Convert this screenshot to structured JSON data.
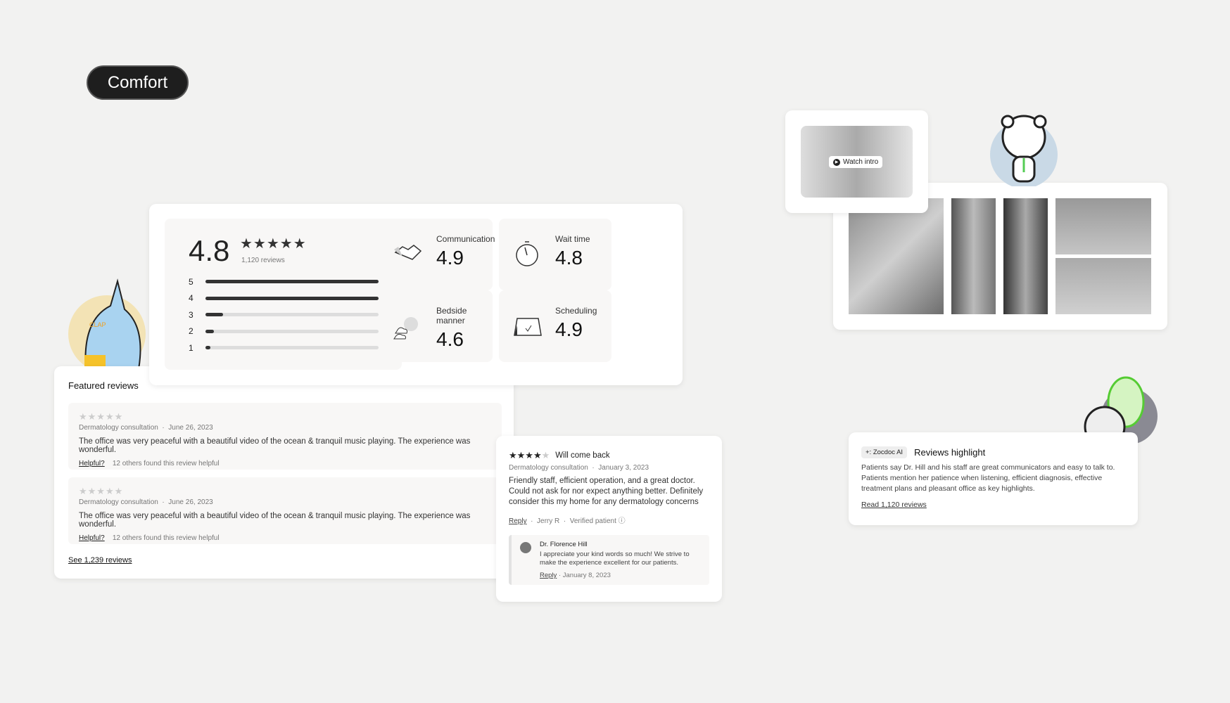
{
  "tag": "Comfort",
  "summary": {
    "rating": "4.8",
    "stars": "★★★★★",
    "reviews": "1,120 reviews",
    "bars": [
      {
        "label": "5",
        "fill": 100
      },
      {
        "label": "4",
        "fill": 100
      },
      {
        "label": "3",
        "fill": 10
      },
      {
        "label": "2",
        "fill": 5
      },
      {
        "label": "1",
        "fill": 1
      }
    ]
  },
  "metrics": [
    {
      "label": "Communication",
      "value": "4.9",
      "icon": "handshake-icon"
    },
    {
      "label": "Wait time",
      "value": "4.8",
      "icon": "stopwatch-icon"
    },
    {
      "label": "Bedside manner",
      "value": "4.6",
      "icon": "sun-cloud-icon"
    },
    {
      "label": "Scheduling",
      "value": "4.9",
      "icon": "calendar-check-icon"
    }
  ],
  "featured": {
    "title": "Featured reviews",
    "see_all": "See 1,239 reviews",
    "reviews": [
      {
        "stars": "★★★★★",
        "type": "Dermatology consultation",
        "date": "June 26, 2023",
        "text": "The office was very peaceful with a beautiful video of the ocean & tranquil music playing. The experience was wonderful.",
        "helpful": "Helpful?",
        "helpful_count": "12 others found this review helpful"
      },
      {
        "stars": "★★★★★",
        "type": "Dermatology consultation",
        "date": "June 26, 2023",
        "text": "The office was very peaceful with a beautiful video of the ocean & tranquil music playing. The experience was wonderful.",
        "helpful": "Helpful?",
        "helpful_count": "12 others found this review helpful"
      }
    ]
  },
  "review": {
    "stars_filled": "★★★★",
    "stars_empty": "★",
    "rating": 4,
    "title": "Will come back",
    "type": "Dermatology consultation",
    "date": "January 3, 2023",
    "text": "Friendly staff, efficient operation, and a great doctor. Could not ask for nor expect anything better. Definitely consider this my home for any dermatology concerns",
    "reply": "Reply",
    "author": "Jerry R",
    "verified": "Verified patient",
    "response": {
      "name": "Dr. Florence Hill",
      "text": "I appreciate your kind words so much! We strive to make the experience excellent for our patients.",
      "reply": "Reply",
      "date": "January 8, 2023"
    }
  },
  "video": {
    "label": "Watch intro"
  },
  "highlight": {
    "badge": "+: Zocdoc AI",
    "title": "Reviews highlight",
    "text": "Patients say Dr. Hill and his staff are great communicators and easy to talk to. Patients mention her patience when listening, efficient diagnosis, effective treatment plans and pleasant office as key highlights.",
    "link": "Read 1,120 reviews"
  },
  "mascot": {
    "clap": "CLAP"
  }
}
